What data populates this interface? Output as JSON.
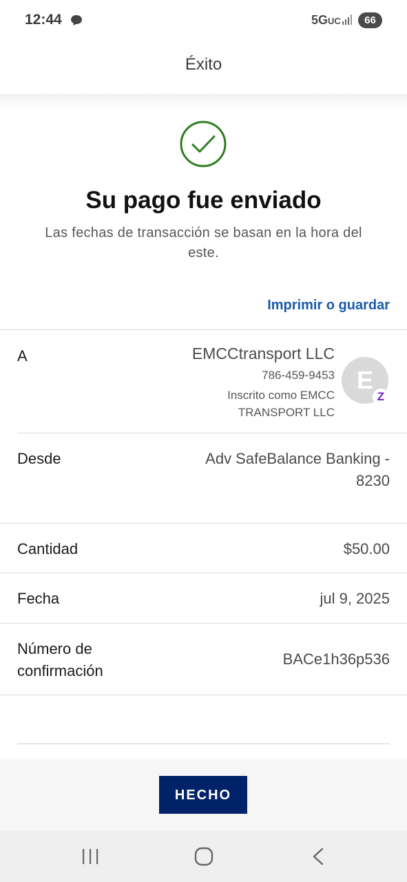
{
  "status_bar": {
    "time": "12:44",
    "network": "5G",
    "network_sub": "UC",
    "battery": "66",
    "icons": [
      "chat-bubble-icon",
      "signal-icon"
    ]
  },
  "header": {
    "title": "Éxito"
  },
  "success": {
    "icon": "check-circle-icon",
    "icon_color": "#2e7d1f",
    "headline": "Su pago fue enviado",
    "note": "Las fechas de transacción se basan en la hora del este."
  },
  "print_link": "Imprimir o guardar",
  "details": {
    "to": {
      "label": "A",
      "name": "EMCCtransport LLC",
      "phone": "786-459-9453",
      "registered": "Inscrito como EMCC TRANSPORT LLC",
      "avatar_initial": "E",
      "badge_icon": "zelle-icon",
      "badge_letter": "Z"
    },
    "from": {
      "label": "Desde",
      "value": "Adv SafeBalance Banking - 8230"
    },
    "amount": {
      "label": "Cantidad",
      "value": "$50.00"
    },
    "date": {
      "label": "Fecha",
      "value": "jul 9, 2025"
    },
    "confirmation": {
      "label": "Número de confirmación",
      "value": "BACe1h36p536"
    }
  },
  "actions": {
    "done": "HECHO"
  },
  "colors": {
    "primary_button": "#012169",
    "link": "#1a5aa8",
    "success": "#2e7d1f"
  },
  "nav_bar": {
    "icons": [
      "recent-apps-icon",
      "home-icon",
      "back-icon"
    ]
  }
}
